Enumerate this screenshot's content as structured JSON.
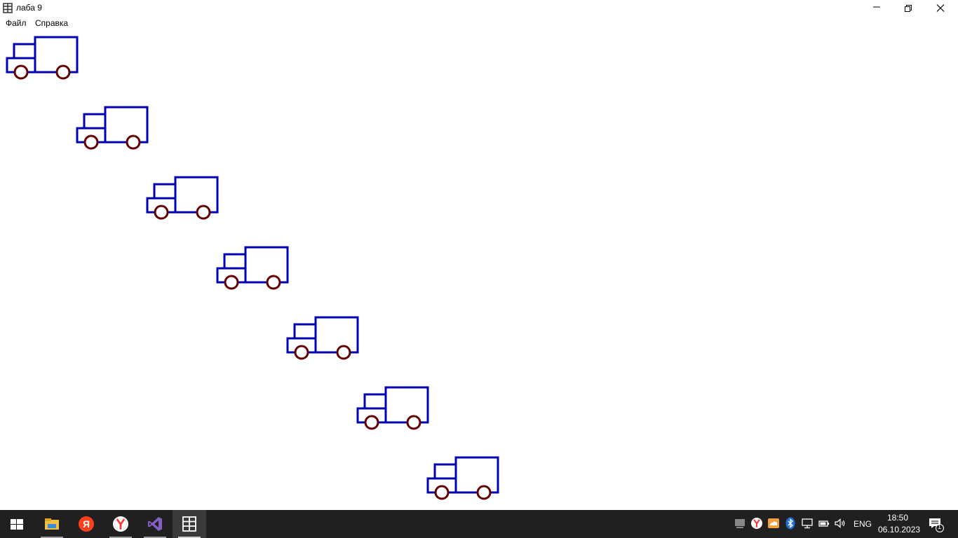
{
  "window": {
    "title": "лаба 9",
    "icon": "app-grid-icon",
    "controls": [
      "minimize-icon",
      "restore-icon",
      "close-icon"
    ]
  },
  "menu": {
    "items": [
      {
        "label": "Файл"
      },
      {
        "label": "Справка"
      }
    ]
  },
  "canvas": {
    "truck_count": 7,
    "body_color": "#0000b4",
    "wheel_color": "#640000"
  },
  "taskbar": {
    "apps": [
      {
        "icon": "start-windows-icon"
      },
      {
        "icon": "file-explorer-icon"
      },
      {
        "icon": "yandex-icon"
      },
      {
        "icon": "yandex-browser-icon"
      },
      {
        "icon": "visual-studio-icon"
      },
      {
        "icon": "app-grid-icon"
      }
    ],
    "tray": {
      "language": "ENG",
      "time": "18:50",
      "date": "06.10.2023",
      "notification_count": "1"
    }
  }
}
